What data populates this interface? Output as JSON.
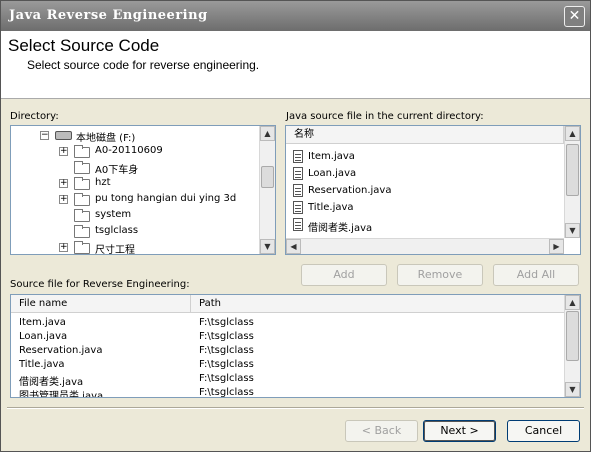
{
  "window": {
    "title": "Java Reverse Engineering",
    "close_glyph": "✕"
  },
  "header": {
    "title": "Select Source Code",
    "subtitle": "Select source code for reverse engineering."
  },
  "directory": {
    "label": "Directory:",
    "root": "本地磁盘 (F:)",
    "items": [
      {
        "label": "A0-20110609",
        "expandable": true
      },
      {
        "label": "A0下车身",
        "expandable": false
      },
      {
        "label": "hzt",
        "expandable": true
      },
      {
        "label": "pu tong hangian dui ying 3d",
        "expandable": true
      },
      {
        "label": "system",
        "expandable": false
      },
      {
        "label": "tsglclass",
        "expandable": false
      },
      {
        "label": "尺寸工程",
        "expandable": true
      }
    ]
  },
  "java_files": {
    "label": "Java source file in the current directory:",
    "column_header": "名称",
    "items": [
      "Item.java",
      "Loan.java",
      "Reservation.java",
      "Title.java",
      "借阅者类.java"
    ]
  },
  "actions": {
    "add": "Add",
    "remove": "Remove",
    "add_all": "Add All"
  },
  "reverse_files": {
    "label": "Source file for Reverse Engineering:",
    "columns": [
      "File name",
      "Path"
    ],
    "rows": [
      [
        "Item.java",
        "F:\\tsglclass"
      ],
      [
        "Loan.java",
        "F:\\tsglclass"
      ],
      [
        "Reservation.java",
        "F:\\tsglclass"
      ],
      [
        "Title.java",
        "F:\\tsglclass"
      ],
      [
        "借阅者类.java",
        "F:\\tsglclass"
      ],
      [
        "图书管理员类.java",
        "F:\\tsglclass"
      ]
    ]
  },
  "footer": {
    "back": "< Back",
    "next": "Next >",
    "cancel": "Cancel"
  }
}
